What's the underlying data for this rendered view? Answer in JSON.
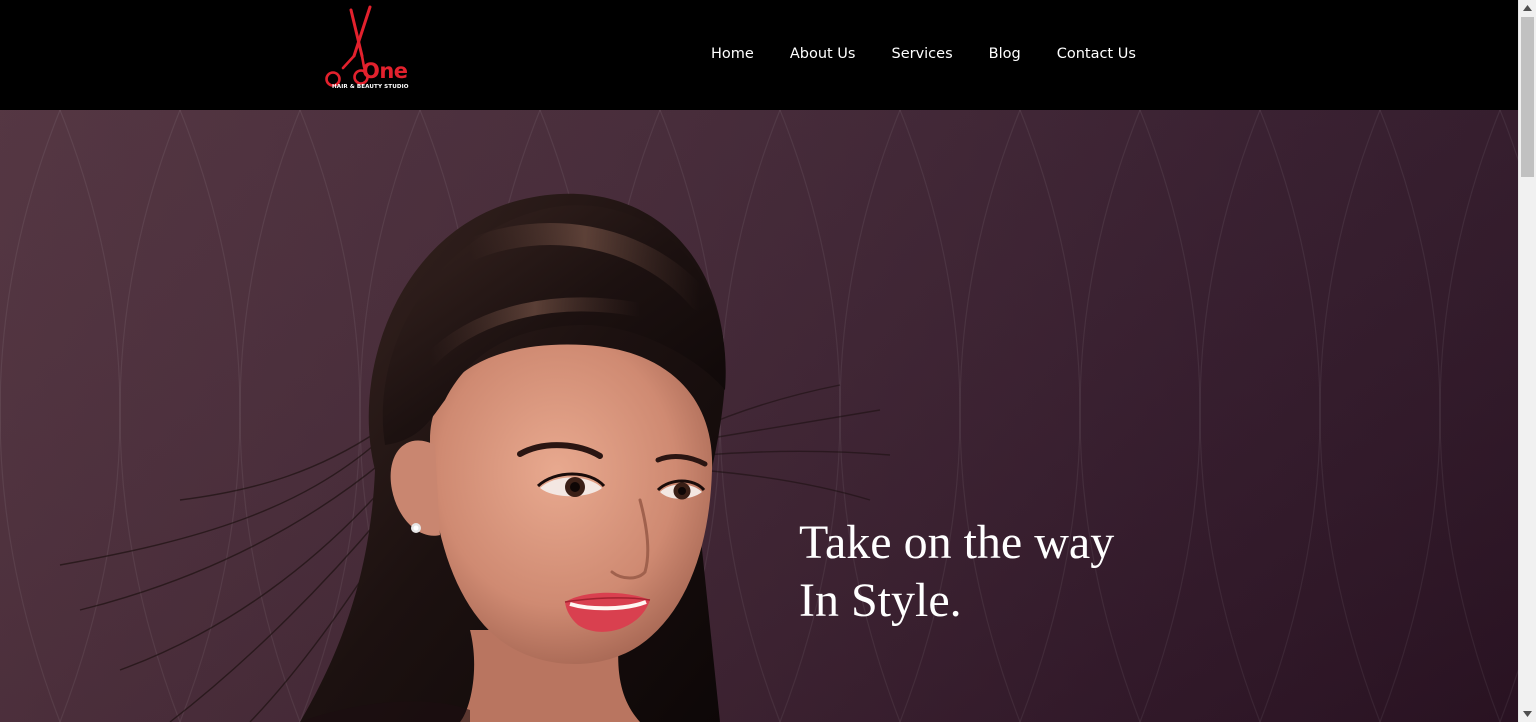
{
  "brand": {
    "name": "One",
    "tagline": "HAIR & BEAUTY STUDIO",
    "accent_color": "#e3212d",
    "logo_icon": "scissors-icon"
  },
  "nav": {
    "items": [
      {
        "label": "Home"
      },
      {
        "label": "About Us"
      },
      {
        "label": "Services"
      },
      {
        "label": "Blog"
      },
      {
        "label": "Contact Us"
      }
    ]
  },
  "hero": {
    "headline_line1": "Take on the way",
    "headline_line2": "In Style.",
    "background_color": "#3f2231"
  },
  "scrollbar": {
    "up_icon": "scroll-up-arrow-icon",
    "down_icon": "scroll-down-arrow-icon"
  }
}
